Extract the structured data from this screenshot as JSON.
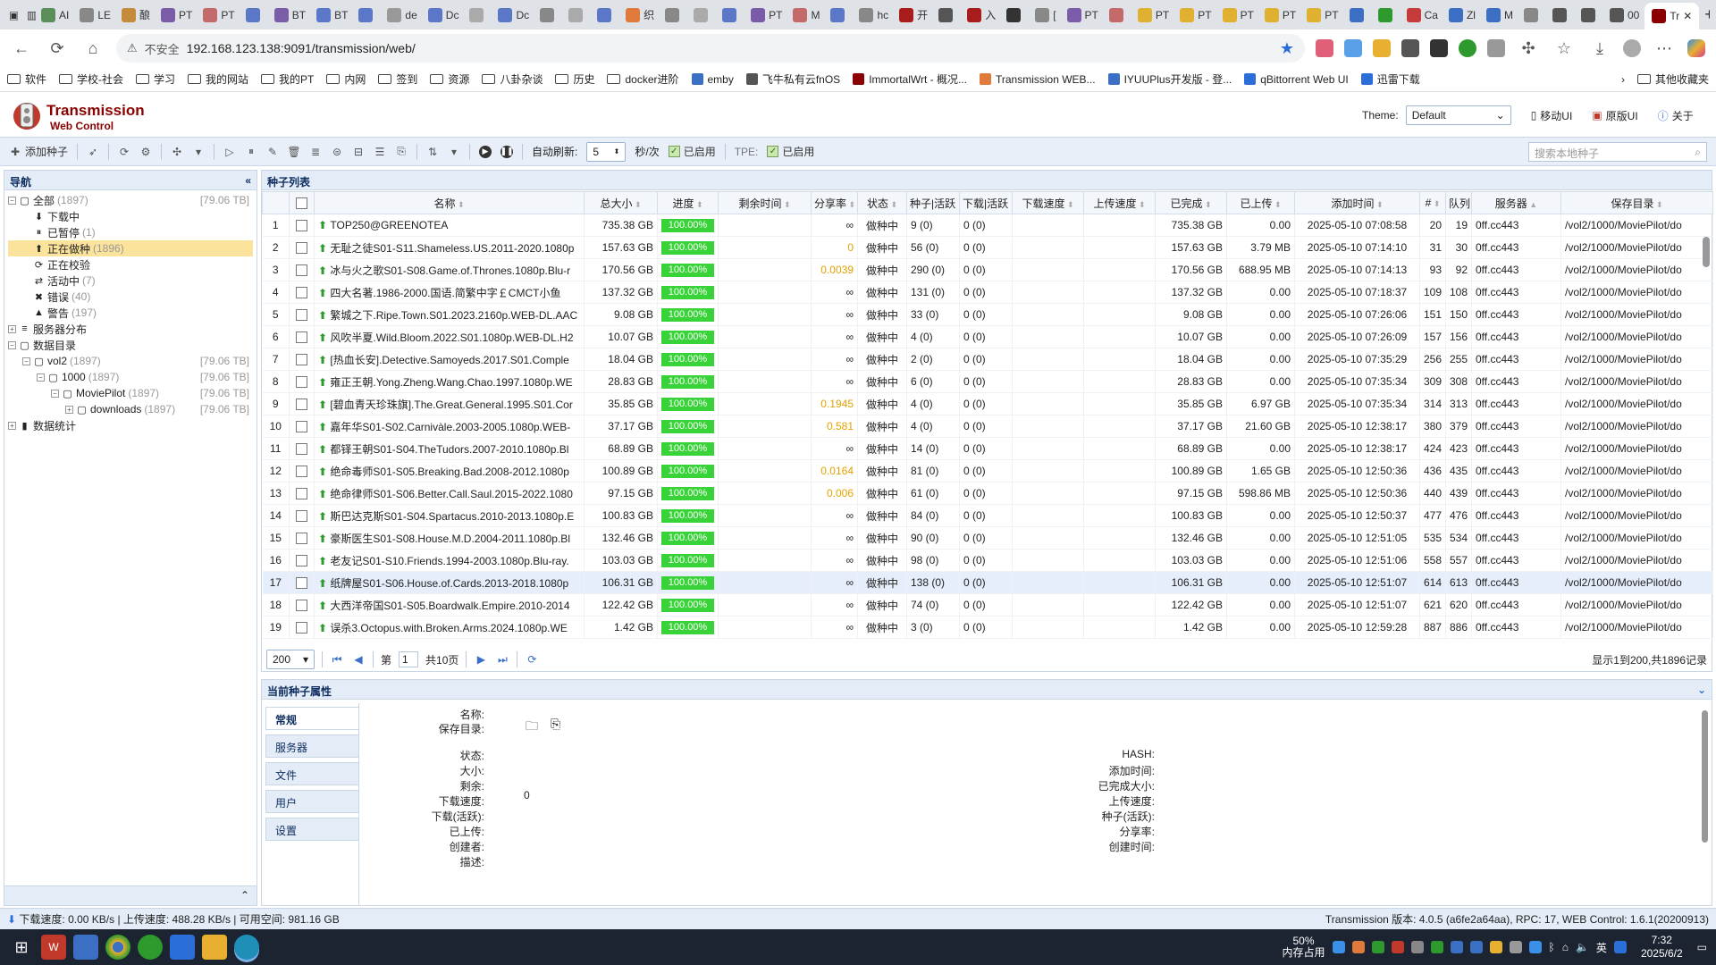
{
  "browser": {
    "tabs": [
      "AI",
      "LE",
      "酿",
      "PT",
      "PT",
      "",
      "BT",
      "BT",
      "",
      "de",
      "Dc",
      "",
      "Dc",
      "",
      "",
      "",
      "织",
      "",
      "",
      "",
      "PT",
      "M",
      "",
      "hc",
      "开",
      "",
      "入",
      "",
      "[",
      "PT",
      "",
      "PT",
      "PT",
      "PT",
      "PT",
      "PT",
      "",
      "",
      "Ca",
      "Zl",
      "M",
      "",
      "",
      "",
      "00",
      "Tr"
    ],
    "tab_colors": [
      "#5a8f5a",
      "#888",
      "#c58b3a",
      "#7a5ca8",
      "#c56a6a",
      "#5b78c8",
      "#7a5ca8",
      "#5b78c8",
      "#5b78c8",
      "#999",
      "#5b78c8",
      "#aaa",
      "#5b78c8",
      "#888",
      "#aaa",
      "#5b78c8",
      "#e07a3a",
      "#888",
      "#aaa",
      "#5b78c8",
      "#7a5ca8",
      "#c56a6a",
      "#5b78c8",
      "#888",
      "#a81c1c",
      "#555",
      "#a81c1c",
      "#333",
      "#888",
      "#7a5ca8",
      "#c56a6a",
      "#e0b030",
      "#e0b030",
      "#e0b030",
      "#e0b030",
      "#e0b030",
      "#3a6fc4",
      "#2e9a2e",
      "#c53a3a",
      "#3a6fc4",
      "#3a6fc4",
      "#888",
      "#555",
      "#555",
      "#555",
      "#8b0000"
    ],
    "active_tab": "Tr",
    "insecure_label": "不安全",
    "url": "192.168.123.138:9091/transmission/web/",
    "bookmarks": [
      "软件",
      "学校-社会",
      "学习",
      "我的网站",
      "我的PT",
      "内网",
      "签到",
      "资源",
      "八卦杂谈",
      "历史",
      "docker进阶",
      "emby",
      "飞牛私有云fnOS",
      "ImmortalWrt - 概况...",
      "Transmission WEB...",
      "IYUUPlus开发版 - 登...",
      "qBittorrent Web UI",
      "迅雷下载"
    ],
    "other_bookmarks": "其他收藏夹"
  },
  "header": {
    "title": "Transmission",
    "subtitle": "Web Control",
    "theme_label": "Theme:",
    "theme_value": "Default",
    "links": [
      "移动UI",
      "原版UI",
      "关于"
    ]
  },
  "toolbar": {
    "add": "添加种子",
    "auto_refresh": "自动刷新:",
    "refresh_value": "5",
    "unit": "秒/次",
    "enabled": "已启用",
    "tpe": "TPE:",
    "tpe_enabled": "已启用",
    "search_placeholder": "搜索本地种子"
  },
  "nav": {
    "title": "导航",
    "nodes": [
      {
        "label": "全部",
        "count": "(1897)",
        "size": "[79.06 TB]",
        "level": 0,
        "icon": "▢",
        "exp": "−",
        "sel": false
      },
      {
        "label": "下载中",
        "count": "",
        "size": "",
        "level": 1,
        "icon": "⬇",
        "exp": "",
        "sel": false
      },
      {
        "label": "已暂停",
        "count": "(1)",
        "size": "",
        "level": 1,
        "icon": "⏸",
        "exp": "",
        "sel": false
      },
      {
        "label": "正在做种",
        "count": "(1896)",
        "size": "",
        "level": 1,
        "icon": "⬆",
        "exp": "",
        "sel": true
      },
      {
        "label": "正在校验",
        "count": "",
        "size": "",
        "level": 1,
        "icon": "⟳",
        "exp": "",
        "sel": false
      },
      {
        "label": "活动中",
        "count": "(7)",
        "size": "",
        "level": 1,
        "icon": "⇄",
        "exp": "",
        "sel": false
      },
      {
        "label": "错误",
        "count": "(40)",
        "size": "",
        "level": 1,
        "icon": "✖",
        "exp": "",
        "sel": false
      },
      {
        "label": "警告",
        "count": "(197)",
        "size": "",
        "level": 1,
        "icon": "▲",
        "exp": "",
        "sel": false
      },
      {
        "label": "服务器分布",
        "count": "",
        "size": "",
        "level": 0,
        "icon": "≡",
        "exp": "+",
        "sel": false
      },
      {
        "label": "数据目录",
        "count": "",
        "size": "",
        "level": 0,
        "icon": "▢",
        "exp": "−",
        "sel": false
      },
      {
        "label": "vol2",
        "count": "(1897)",
        "size": "[79.06 TB]",
        "level": 1,
        "icon": "▢",
        "exp": "−",
        "sel": false
      },
      {
        "label": "1000",
        "count": "(1897)",
        "size": "[79.06 TB]",
        "level": 2,
        "icon": "▢",
        "exp": "−",
        "sel": false
      },
      {
        "label": "MoviePilot",
        "count": "(1897)",
        "size": "[79.06 TB]",
        "level": 3,
        "icon": "▢",
        "exp": "−",
        "sel": false
      },
      {
        "label": "downloads",
        "count": "(1897)",
        "size": "[79.06 TB]",
        "level": 4,
        "icon": "▢",
        "exp": "+",
        "sel": false
      },
      {
        "label": "数据统计",
        "count": "",
        "size": "",
        "level": 0,
        "icon": "▮",
        "exp": "+",
        "sel": false
      }
    ]
  },
  "list": {
    "title": "种子列表",
    "columns": [
      "",
      "",
      "名称",
      "总大小",
      "进度",
      "剩余时间",
      "分享率",
      "状态",
      "种子|活跃",
      "下载|活跃",
      "下载速度",
      "上传速度",
      "已完成",
      "已上传",
      "添加时间",
      "#",
      "队列",
      "服务器",
      "保存目录"
    ],
    "rows": [
      [
        "1",
        "TOP250@GREENOTEA",
        "735.38 GB",
        "100.00%",
        "",
        "∞",
        "做种中",
        "9 (0)",
        "0 (0)",
        "",
        "",
        "735.38 GB",
        "0.00",
        "2025-05-10 07:08:58",
        "20",
        "19",
        "0ff.cc443",
        "/vol2/1000/MoviePilot/do"
      ],
      [
        "2",
        "无耻之徒S01-S11.Shameless.US.2011-2020.1080p",
        "157.63 GB",
        "100.00%",
        "",
        "0",
        "做种中",
        "56 (0)",
        "0 (0)",
        "",
        "",
        "157.63 GB",
        "3.79 MB",
        "2025-05-10 07:14:10",
        "31",
        "30",
        "0ff.cc443",
        "/vol2/1000/MoviePilot/do"
      ],
      [
        "3",
        "冰与火之歌S01-S08.Game.of.Thrones.1080p.Blu-r",
        "170.56 GB",
        "100.00%",
        "",
        "0.0039",
        "做种中",
        "290 (0)",
        "0 (0)",
        "",
        "",
        "170.56 GB",
        "688.95 MB",
        "2025-05-10 07:14:13",
        "93",
        "92",
        "0ff.cc443",
        "/vol2/1000/MoviePilot/do"
      ],
      [
        "4",
        "四大名著.1986-2000.国语.简繁中字￡CMCT小鱼",
        "137.32 GB",
        "100.00%",
        "",
        "∞",
        "做种中",
        "131 (0)",
        "0 (0)",
        "",
        "",
        "137.32 GB",
        "0.00",
        "2025-05-10 07:18:37",
        "109",
        "108",
        "0ff.cc443",
        "/vol2/1000/MoviePilot/do"
      ],
      [
        "5",
        "繁城之下.Ripe.Town.S01.2023.2160p.WEB-DL.AAC",
        "9.08 GB",
        "100.00%",
        "",
        "∞",
        "做种中",
        "33 (0)",
        "0 (0)",
        "",
        "",
        "9.08 GB",
        "0.00",
        "2025-05-10 07:26:06",
        "151",
        "150",
        "0ff.cc443",
        "/vol2/1000/MoviePilot/do"
      ],
      [
        "6",
        "风吹半夏.Wild.Bloom.2022.S01.1080p.WEB-DL.H2",
        "10.07 GB",
        "100.00%",
        "",
        "∞",
        "做种中",
        "4 (0)",
        "0 (0)",
        "",
        "",
        "10.07 GB",
        "0.00",
        "2025-05-10 07:26:09",
        "157",
        "156",
        "0ff.cc443",
        "/vol2/1000/MoviePilot/do"
      ],
      [
        "7",
        "[热血长安].Detective.Samoyeds.2017.S01.Comple",
        "18.04 GB",
        "100.00%",
        "",
        "∞",
        "做种中",
        "2 (0)",
        "0 (0)",
        "",
        "",
        "18.04 GB",
        "0.00",
        "2025-05-10 07:35:29",
        "256",
        "255",
        "0ff.cc443",
        "/vol2/1000/MoviePilot/do"
      ],
      [
        "8",
        "雍正王朝.Yong.Zheng.Wang.Chao.1997.1080p.WE",
        "28.83 GB",
        "100.00%",
        "",
        "∞",
        "做种中",
        "6 (0)",
        "0 (0)",
        "",
        "",
        "28.83 GB",
        "0.00",
        "2025-05-10 07:35:34",
        "309",
        "308",
        "0ff.cc443",
        "/vol2/1000/MoviePilot/do"
      ],
      [
        "9",
        "[碧血青天珍珠旗].The.Great.General.1995.S01.Cor",
        "35.85 GB",
        "100.00%",
        "",
        "0.1945",
        "做种中",
        "4 (0)",
        "0 (0)",
        "",
        "",
        "35.85 GB",
        "6.97 GB",
        "2025-05-10 07:35:34",
        "314",
        "313",
        "0ff.cc443",
        "/vol2/1000/MoviePilot/do"
      ],
      [
        "10",
        "嘉年华S01-S02.Carnivàle.2003-2005.1080p.WEB-",
        "37.17 GB",
        "100.00%",
        "",
        "0.581",
        "做种中",
        "4 (0)",
        "0 (0)",
        "",
        "",
        "37.17 GB",
        "21.60 GB",
        "2025-05-10 12:38:17",
        "380",
        "379",
        "0ff.cc443",
        "/vol2/1000/MoviePilot/do"
      ],
      [
        "11",
        "都铎王朝S01-S04.TheTudors.2007-2010.1080p.Bl",
        "68.89 GB",
        "100.00%",
        "",
        "∞",
        "做种中",
        "14 (0)",
        "0 (0)",
        "",
        "",
        "68.89 GB",
        "0.00",
        "2025-05-10 12:38:17",
        "424",
        "423",
        "0ff.cc443",
        "/vol2/1000/MoviePilot/do"
      ],
      [
        "12",
        "绝命毒师S01-S05.Breaking.Bad.2008-2012.1080p",
        "100.89 GB",
        "100.00%",
        "",
        "0.0164",
        "做种中",
        "81 (0)",
        "0 (0)",
        "",
        "",
        "100.89 GB",
        "1.65 GB",
        "2025-05-10 12:50:36",
        "436",
        "435",
        "0ff.cc443",
        "/vol2/1000/MoviePilot/do"
      ],
      [
        "13",
        "绝命律师S01-S06.Better.Call.Saul.2015-2022.1080",
        "97.15 GB",
        "100.00%",
        "",
        "0.006",
        "做种中",
        "61 (0)",
        "0 (0)",
        "",
        "",
        "97.15 GB",
        "598.86 MB",
        "2025-05-10 12:50:36",
        "440",
        "439",
        "0ff.cc443",
        "/vol2/1000/MoviePilot/do"
      ],
      [
        "14",
        "斯巴达克斯S01-S04.Spartacus.2010-2013.1080p.E",
        "100.83 GB",
        "100.00%",
        "",
        "∞",
        "做种中",
        "84 (0)",
        "0 (0)",
        "",
        "",
        "100.83 GB",
        "0.00",
        "2025-05-10 12:50:37",
        "477",
        "476",
        "0ff.cc443",
        "/vol2/1000/MoviePilot/do"
      ],
      [
        "15",
        "豪斯医生S01-S08.House.M.D.2004-2011.1080p.Bl",
        "132.46 GB",
        "100.00%",
        "",
        "∞",
        "做种中",
        "90 (0)",
        "0 (0)",
        "",
        "",
        "132.46 GB",
        "0.00",
        "2025-05-10 12:51:05",
        "535",
        "534",
        "0ff.cc443",
        "/vol2/1000/MoviePilot/do"
      ],
      [
        "16",
        "老友记S01-S10.Friends.1994-2003.1080p.Blu-ray.",
        "103.03 GB",
        "100.00%",
        "",
        "∞",
        "做种中",
        "98 (0)",
        "0 (0)",
        "",
        "",
        "103.03 GB",
        "0.00",
        "2025-05-10 12:51:06",
        "558",
        "557",
        "0ff.cc443",
        "/vol2/1000/MoviePilot/do"
      ],
      [
        "17",
        "纸牌屋S01-S06.House.of.Cards.2013-2018.1080p",
        "106.31 GB",
        "100.00%",
        "",
        "∞",
        "做种中",
        "138 (0)",
        "0 (0)",
        "",
        "",
        "106.31 GB",
        "0.00",
        "2025-05-10 12:51:07",
        "614",
        "613",
        "0ff.cc443",
        "/vol2/1000/MoviePilot/do"
      ],
      [
        "18",
        "大西洋帝国S01-S05.Boardwalk.Empire.2010-2014",
        "122.42 GB",
        "100.00%",
        "",
        "∞",
        "做种中",
        "74 (0)",
        "0 (0)",
        "",
        "",
        "122.42 GB",
        "0.00",
        "2025-05-10 12:51:07",
        "621",
        "620",
        "0ff.cc443",
        "/vol2/1000/MoviePilot/do"
      ],
      [
        "19",
        "误杀3.Octopus.with.Broken.Arms.2024.1080p.WE",
        "1.42 GB",
        "100.00%",
        "",
        "∞",
        "做种中",
        "3 (0)",
        "0 (0)",
        "",
        "",
        "1.42 GB",
        "0.00",
        "2025-05-10 12:59:28",
        "887",
        "886",
        "0ff.cc443",
        "/vol2/1000/MoviePilot/do"
      ]
    ],
    "highlight_row": 17
  },
  "pager": {
    "page_size": "200",
    "page_prefix": "第",
    "page": "1",
    "page_total": "共10页",
    "summary": "显示1到200,共1896记录"
  },
  "props": {
    "title": "当前种子属性",
    "tabs": [
      "常规",
      "服务器",
      "文件",
      "用户",
      "设置"
    ],
    "left_fields": [
      "名称:",
      "保存目录:",
      "状态:",
      "大小:",
      "剩余:",
      "下载速度:",
      "下载(活跃):",
      "已上传:",
      "创建者:",
      "描述:"
    ],
    "remaining_value": "0",
    "right_fields": [
      "HASH:",
      "添加时间:",
      "已完成大小:",
      "上传速度:",
      "种子(活跃):",
      "分享率:",
      "创建时间:"
    ]
  },
  "status": {
    "left": "下载速度: 0.00 KB/s | 上传速度: 488.28 KB/s | 可用空间: 981.16 GB",
    "right": "Transmission 版本: 4.0.5 (a6fe2a64aa), RPC: 17, WEB Control: 1.6.1(20200913)"
  },
  "taskbar": {
    "mem_percent": "50%",
    "mem_label": "内存占用",
    "ime": "英",
    "time": "7:32",
    "date": "2025/6/2"
  }
}
